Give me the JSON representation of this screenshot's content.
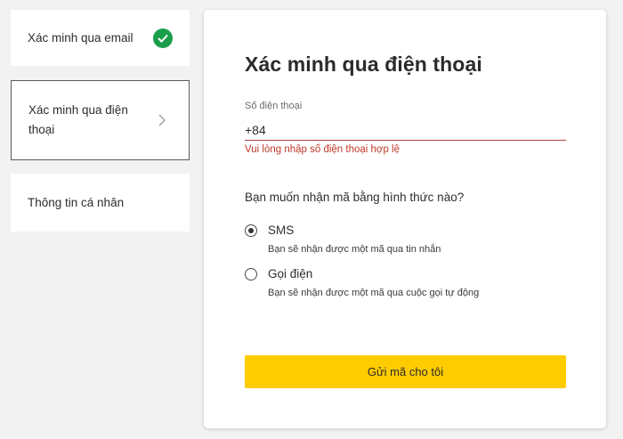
{
  "steps": [
    {
      "label": "Xác minh qua email",
      "status": "complete",
      "icon": "check-circle-icon"
    },
    {
      "label": "Xác minh qua điện thoại",
      "status": "active",
      "icon": "chevron-right-icon"
    },
    {
      "label": "Thông tin cá nhân",
      "status": "pending"
    }
  ],
  "form": {
    "title": "Xác minh qua điện thoại",
    "phone_label": "Số điện thoại",
    "phone_value": "+84",
    "phone_error": "Vui lòng nhập số điện thoại hợp lệ",
    "method_question": "Bạn muốn nhận mã bằng hình thức nào?",
    "options": [
      {
        "label": "SMS",
        "description": "Bạn sẽ nhận được một mã qua tin nhắn",
        "selected": true
      },
      {
        "label": "Gọi điện",
        "description": "Bạn sẽ nhận được một mã qua cuộc gọi tự động",
        "selected": false
      }
    ],
    "submit_label": "Gửi mã cho tôi"
  },
  "colors": {
    "accent": "#ffcc00",
    "success": "#1a9e4b",
    "error": "#c0392b",
    "background": "#f2f2f2"
  }
}
